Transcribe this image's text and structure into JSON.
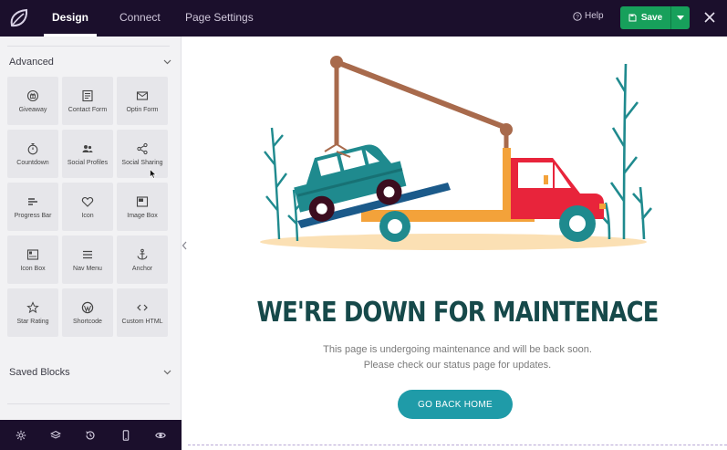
{
  "topbar": {
    "tabs": [
      {
        "label": "Design",
        "active": true
      },
      {
        "label": "Connect",
        "active": false
      },
      {
        "label": "Page Settings",
        "active": false
      }
    ],
    "help_label": "Help",
    "save_label": "Save",
    "icons": [
      "leaf-logo-icon",
      "help-circle-icon",
      "save-disk-icon",
      "caret-down-icon",
      "close-icon"
    ]
  },
  "sidebar": {
    "advanced_title": "Advanced",
    "blocks": [
      {
        "label": "Giveaway",
        "icon": "gift-icon"
      },
      {
        "label": "Contact Form",
        "icon": "form-icon"
      },
      {
        "label": "Optin Form",
        "icon": "envelope-icon"
      },
      {
        "label": "Countdown",
        "icon": "stopwatch-icon"
      },
      {
        "label": "Social Profiles",
        "icon": "users-icon"
      },
      {
        "label": "Social Sharing",
        "icon": "share-icon"
      },
      {
        "label": "Progress Bar",
        "icon": "progress-bars-icon"
      },
      {
        "label": "Icon",
        "icon": "heart-icon"
      },
      {
        "label": "Image Box",
        "icon": "image-box-icon"
      },
      {
        "label": "Icon Box",
        "icon": "icon-box-icon"
      },
      {
        "label": "Nav Menu",
        "icon": "hamburger-icon"
      },
      {
        "label": "Anchor",
        "icon": "anchor-icon"
      },
      {
        "label": "Star Rating",
        "icon": "star-icon"
      },
      {
        "label": "Shortcode",
        "icon": "wordpress-icon"
      },
      {
        "label": "Custom HTML",
        "icon": "code-icon"
      }
    ],
    "saved_blocks_title": "Saved Blocks",
    "footer_icons": [
      "settings-gear-icon",
      "layers-icon",
      "history-icon",
      "mobile-icon",
      "eye-preview-icon"
    ]
  },
  "preview": {
    "headline": "WE'RE DOWN FOR MAINTENACE",
    "subtext_line1": "This page is undergoing maintenance and will be back soon.",
    "subtext_line2": "Please check our status page for updates.",
    "button_label": "GO BACK HOME",
    "colors": {
      "headline": "#16494a",
      "button": "#1f9ba8",
      "truck": "#e8243b",
      "car": "#1f8a8e"
    }
  },
  "colors": {
    "topbar": "#1b0f2c",
    "save": "#17a05b",
    "sidebar": "#f2f2f4"
  }
}
